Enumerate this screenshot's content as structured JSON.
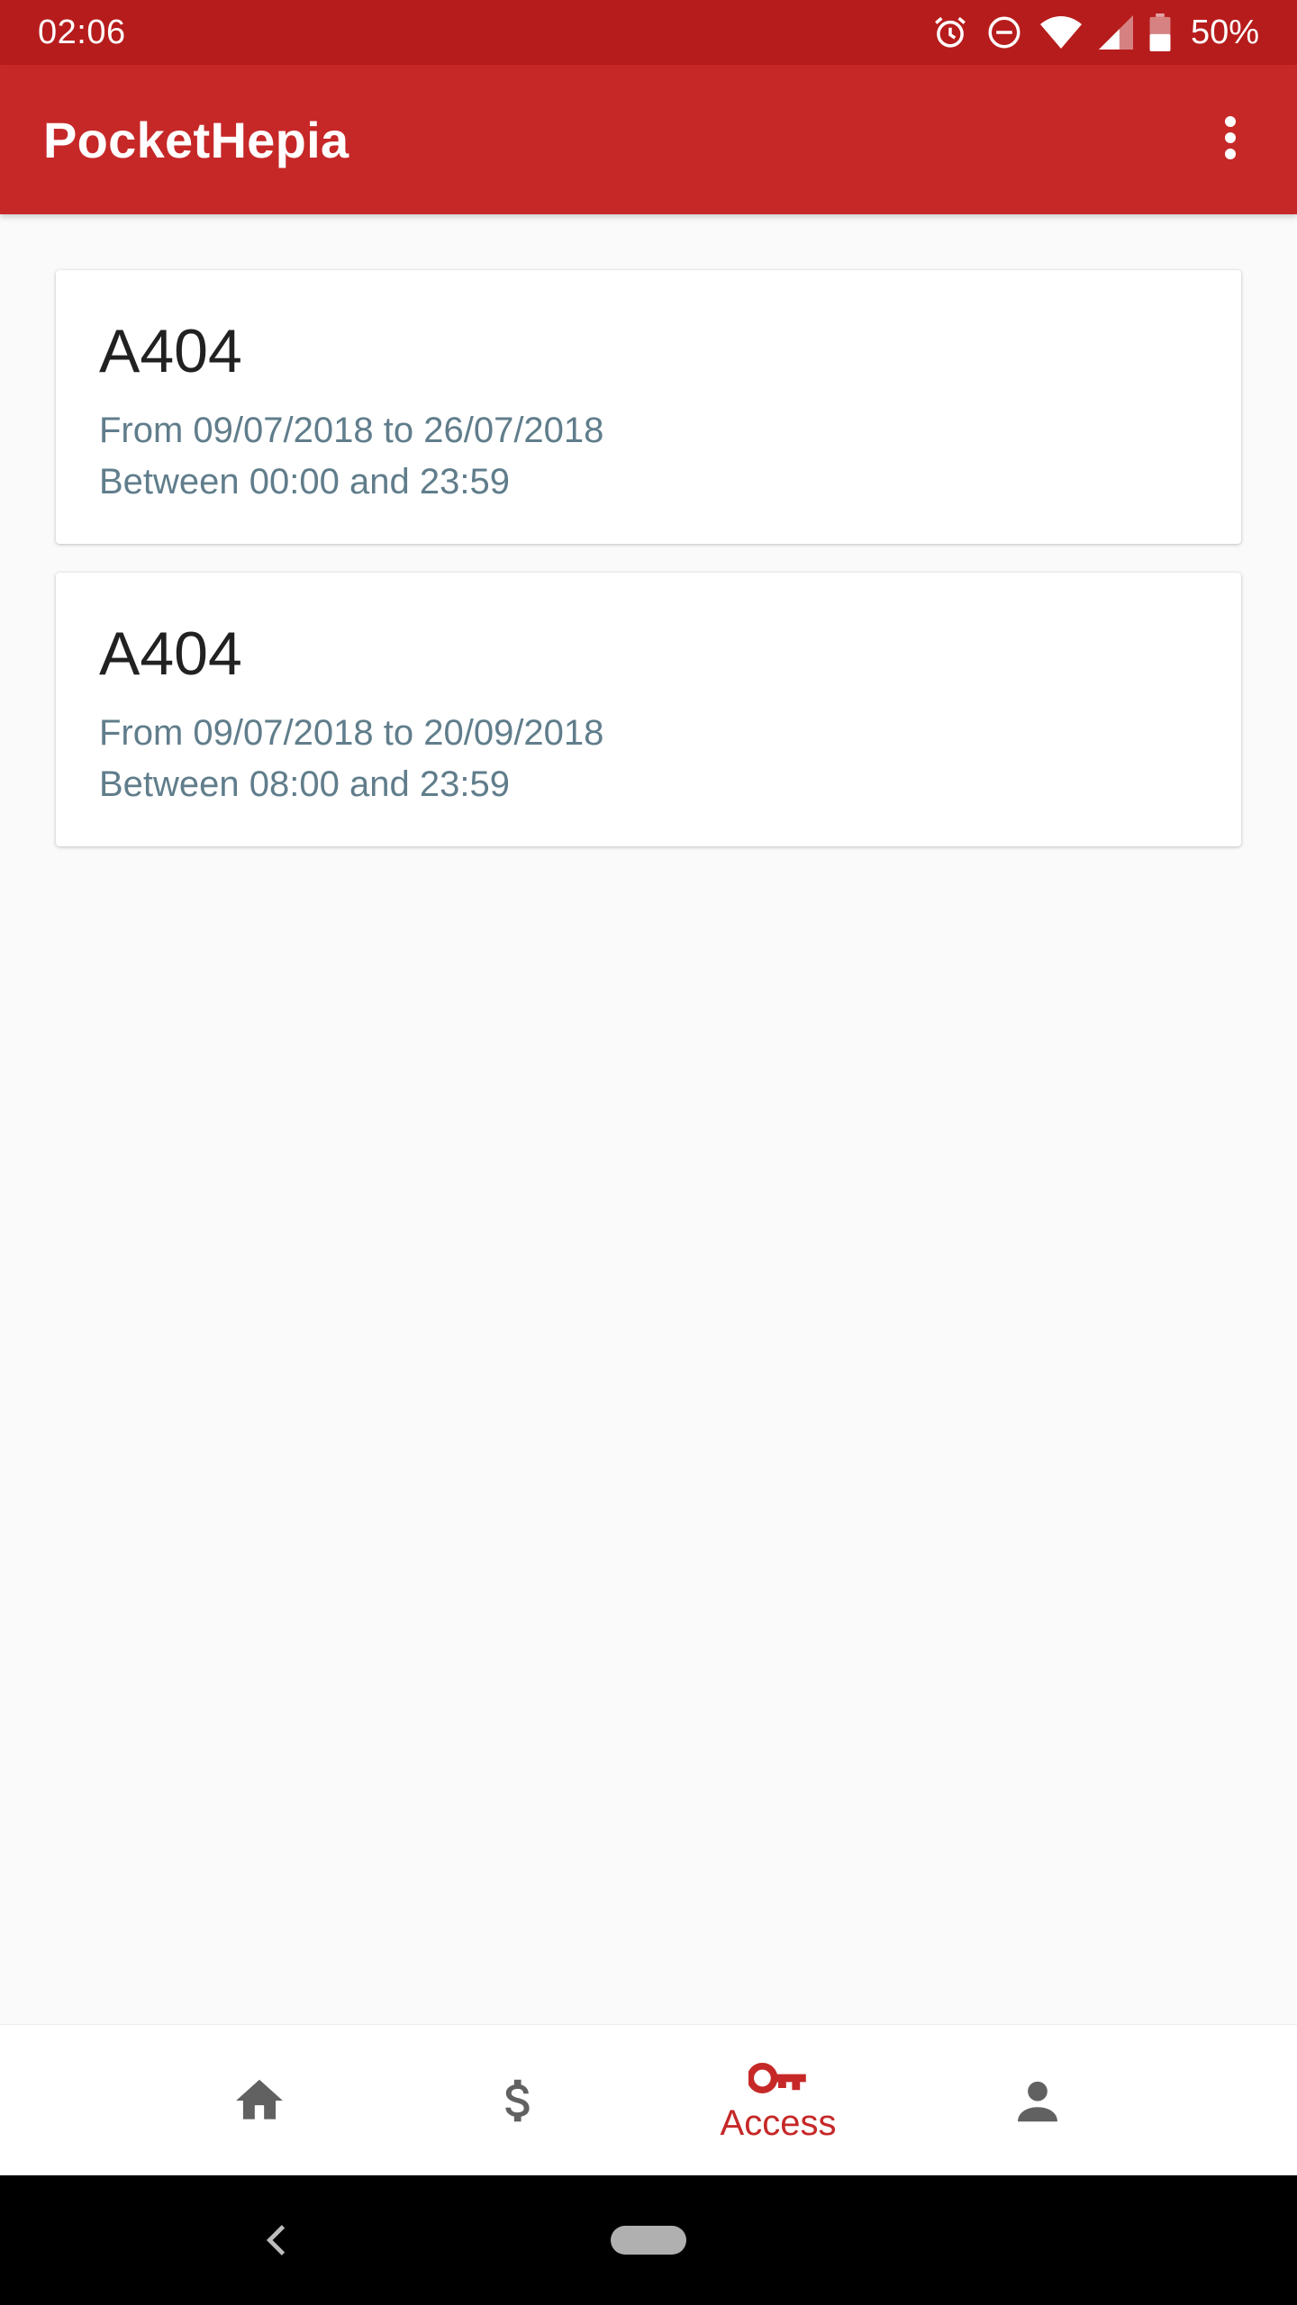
{
  "status_bar": {
    "time": "02:06",
    "battery_percent": "50%",
    "icons": [
      "alarm-icon",
      "do-not-disturb-icon",
      "wifi-icon",
      "cell-signal-icon",
      "battery-icon"
    ]
  },
  "app_bar": {
    "title": "PocketHepia",
    "menu_icon": "more-vert-icon"
  },
  "access_list": [
    {
      "room": "A404",
      "date_range": "From 09/07/2018 to 26/07/2018",
      "time_range": "Between 00:00 and 23:59"
    },
    {
      "room": "A404",
      "date_range": "From 09/07/2018 to 20/09/2018",
      "time_range": "Between 08:00 and 23:59"
    }
  ],
  "bottom_nav": {
    "items": [
      {
        "icon": "home-icon",
        "label": "",
        "active": false
      },
      {
        "icon": "dollar-icon",
        "label": "",
        "active": false
      },
      {
        "icon": "key-icon",
        "label": "Access",
        "active": true
      },
      {
        "icon": "person-icon",
        "label": "",
        "active": false
      }
    ]
  },
  "colors": {
    "status_bar": "#b71c1c",
    "primary": "#c62828",
    "secondary_text": "#607d8b",
    "inactive_icon": "#616161"
  }
}
